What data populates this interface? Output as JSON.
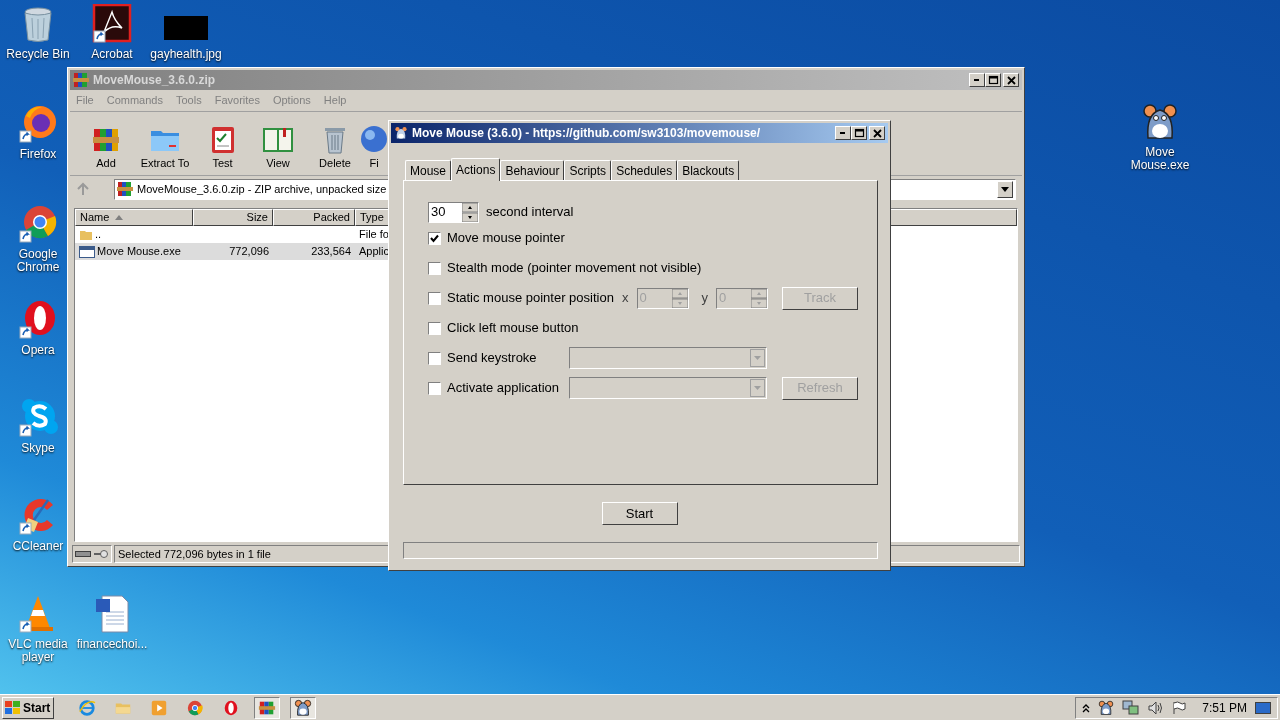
{
  "desktop_icons": [
    {
      "kind": "recycle",
      "label": "Recycle Bin",
      "shortcut": false
    },
    {
      "kind": "acrobat",
      "label": "Acrobat",
      "shortcut": true
    },
    {
      "kind": "image",
      "label": "gayhealth.jpg",
      "shortcut": false
    },
    {
      "kind": "firefox",
      "label": "Firefox",
      "shortcut": true
    },
    {
      "kind": "chrome",
      "label": "Google Chrome",
      "shortcut": true
    },
    {
      "kind": "opera",
      "label": "Opera",
      "shortcut": true
    },
    {
      "kind": "skype",
      "label": "Skype",
      "shortcut": true
    },
    {
      "kind": "ccleaner",
      "label": "CCleaner",
      "shortcut": true
    },
    {
      "kind": "vlc",
      "label": "VLC media player",
      "shortcut": true
    },
    {
      "kind": "word",
      "label": "financechoi...",
      "shortcut": false
    },
    {
      "kind": "mouse",
      "label": "Move Mouse.exe",
      "shortcut": false
    }
  ],
  "archive_window": {
    "title": "MoveMouse_3.6.0.zip",
    "active": false,
    "menu": [
      "File",
      "Commands",
      "Tools",
      "Favorites",
      "Options",
      "Help"
    ],
    "toolbar": [
      {
        "kind": "add",
        "label": "Add"
      },
      {
        "kind": "extract",
        "label": "Extract To"
      },
      {
        "kind": "test",
        "label": "Test"
      },
      {
        "kind": "view",
        "label": "View"
      },
      {
        "kind": "delete",
        "label": "Delete"
      },
      {
        "kind": "find",
        "label": "Fi"
      }
    ],
    "path": "MoveMouse_3.6.0.zip - ZIP archive, unpacked size",
    "columns": [
      "Name",
      "Size",
      "Packed",
      "Type"
    ],
    "rows": [
      {
        "kind": "folder",
        "name": "..",
        "size": "",
        "packed": "",
        "type": "File fo",
        "selected": false
      },
      {
        "kind": "exe",
        "name": "Move Mouse.exe",
        "size": "772,096",
        "packed": "233,564",
        "type": "Applic",
        "selected": true
      }
    ],
    "status": "Selected 772,096 bytes in 1 file"
  },
  "dialog": {
    "title": "Move Mouse (3.6.0) - https://github.com/sw3103/movemouse/",
    "active": true,
    "tabs": [
      {
        "label": "Mouse",
        "selected": false
      },
      {
        "label": "Actions",
        "selected": true
      },
      {
        "label": "Behaviour",
        "selected": false
      },
      {
        "label": "Scripts",
        "selected": false
      },
      {
        "label": "Schedules",
        "selected": false
      },
      {
        "label": "Blackouts",
        "selected": false
      }
    ],
    "interval": {
      "value": "30",
      "label": "second interval"
    },
    "options": [
      {
        "kind": "plain",
        "label": "Move mouse pointer",
        "checked": true
      },
      {
        "kind": "plain",
        "label": "Stealth mode (pointer movement not visible)",
        "checked": false
      },
      {
        "kind": "position",
        "label": "Static mouse pointer position",
        "checked": false,
        "x_label": "x",
        "x_value": "0",
        "y_label": "y",
        "y_value": "0",
        "button": "Track",
        "disabled": true
      },
      {
        "kind": "plain",
        "label": "Click left mouse button",
        "checked": false
      },
      {
        "kind": "dropdown",
        "label": "Send keystroke",
        "checked": false,
        "disabled": true
      },
      {
        "kind": "dropdown",
        "label": "Activate application",
        "checked": false,
        "button": "Refresh",
        "disabled": true
      }
    ],
    "start_button": "Start"
  },
  "taskbar": {
    "start": "Start",
    "apps": [
      {
        "kind": "ie",
        "active": false
      },
      {
        "kind": "explorer",
        "active": false
      },
      {
        "kind": "media",
        "active": false
      },
      {
        "kind": "chrome",
        "active": false
      },
      {
        "kind": "opera",
        "active": false
      },
      {
        "kind": "archiver",
        "active": true
      },
      {
        "kind": "mouse",
        "active": true
      }
    ],
    "clock": "7:51 PM"
  }
}
